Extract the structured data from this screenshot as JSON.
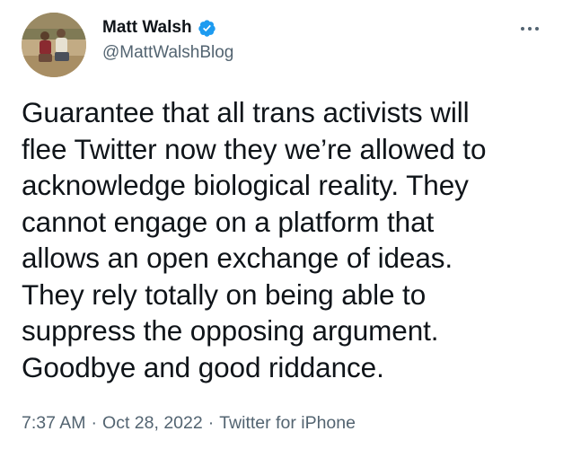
{
  "author": {
    "display_name": "Matt Walsh",
    "handle": "@MattWalshBlog",
    "verified_icon": "verified-badge-icon",
    "avatar": "profile-photo"
  },
  "more_icon": "ellipsis-icon",
  "tweet": {
    "lines": [
      "Guarantee that all trans activists will",
      "flee Twitter now they we’re allowed to",
      "acknowledge biological reality. They",
      "cannot engage on a platform that",
      "allows an open exchange of ideas.",
      "They rely totally on being able to",
      "suppress the opposing argument.",
      "Goodbye and good riddance."
    ]
  },
  "meta": {
    "time": "7:37 AM",
    "date": "Oct 28, 2022",
    "source": "Twitter for iPhone",
    "separator": "·"
  },
  "colors": {
    "text": "#0f1419",
    "secondary": "#536471",
    "verified": "#1d9bf0"
  }
}
